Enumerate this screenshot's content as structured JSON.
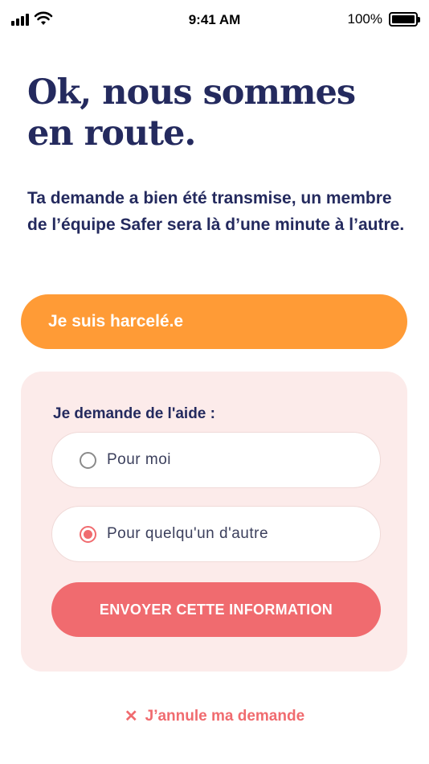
{
  "status_bar": {
    "time": "9:41 AM",
    "battery_percent": "100%",
    "battery_level": 1.0,
    "icons": [
      "signal-icon",
      "wifi-icon",
      "battery-icon"
    ]
  },
  "headline": "Ok, nous sommes en route.",
  "subtitle": "Ta demande a bien été transmise, un membre de l’équipe Safer sera là d’une minute à l’autre.",
  "harassed_button": {
    "label": "Je suis harcelé.e"
  },
  "help_section": {
    "label": "Je demande de l'aide :",
    "options": [
      {
        "label": "Pour moi",
        "selected": false
      },
      {
        "label": "Pour quelqu'un d'autre",
        "selected": true
      }
    ],
    "send_button": {
      "label": "ENVOYER CETTE INFORMATION"
    }
  },
  "cancel": {
    "icon": "close-icon",
    "icon_glyph": "✕",
    "label": "J’annule ma demande"
  },
  "colors": {
    "navy": "#242a5e",
    "orange": "#ff9b36",
    "coral": "#f06b6f",
    "card_pink": "#fcebea"
  }
}
